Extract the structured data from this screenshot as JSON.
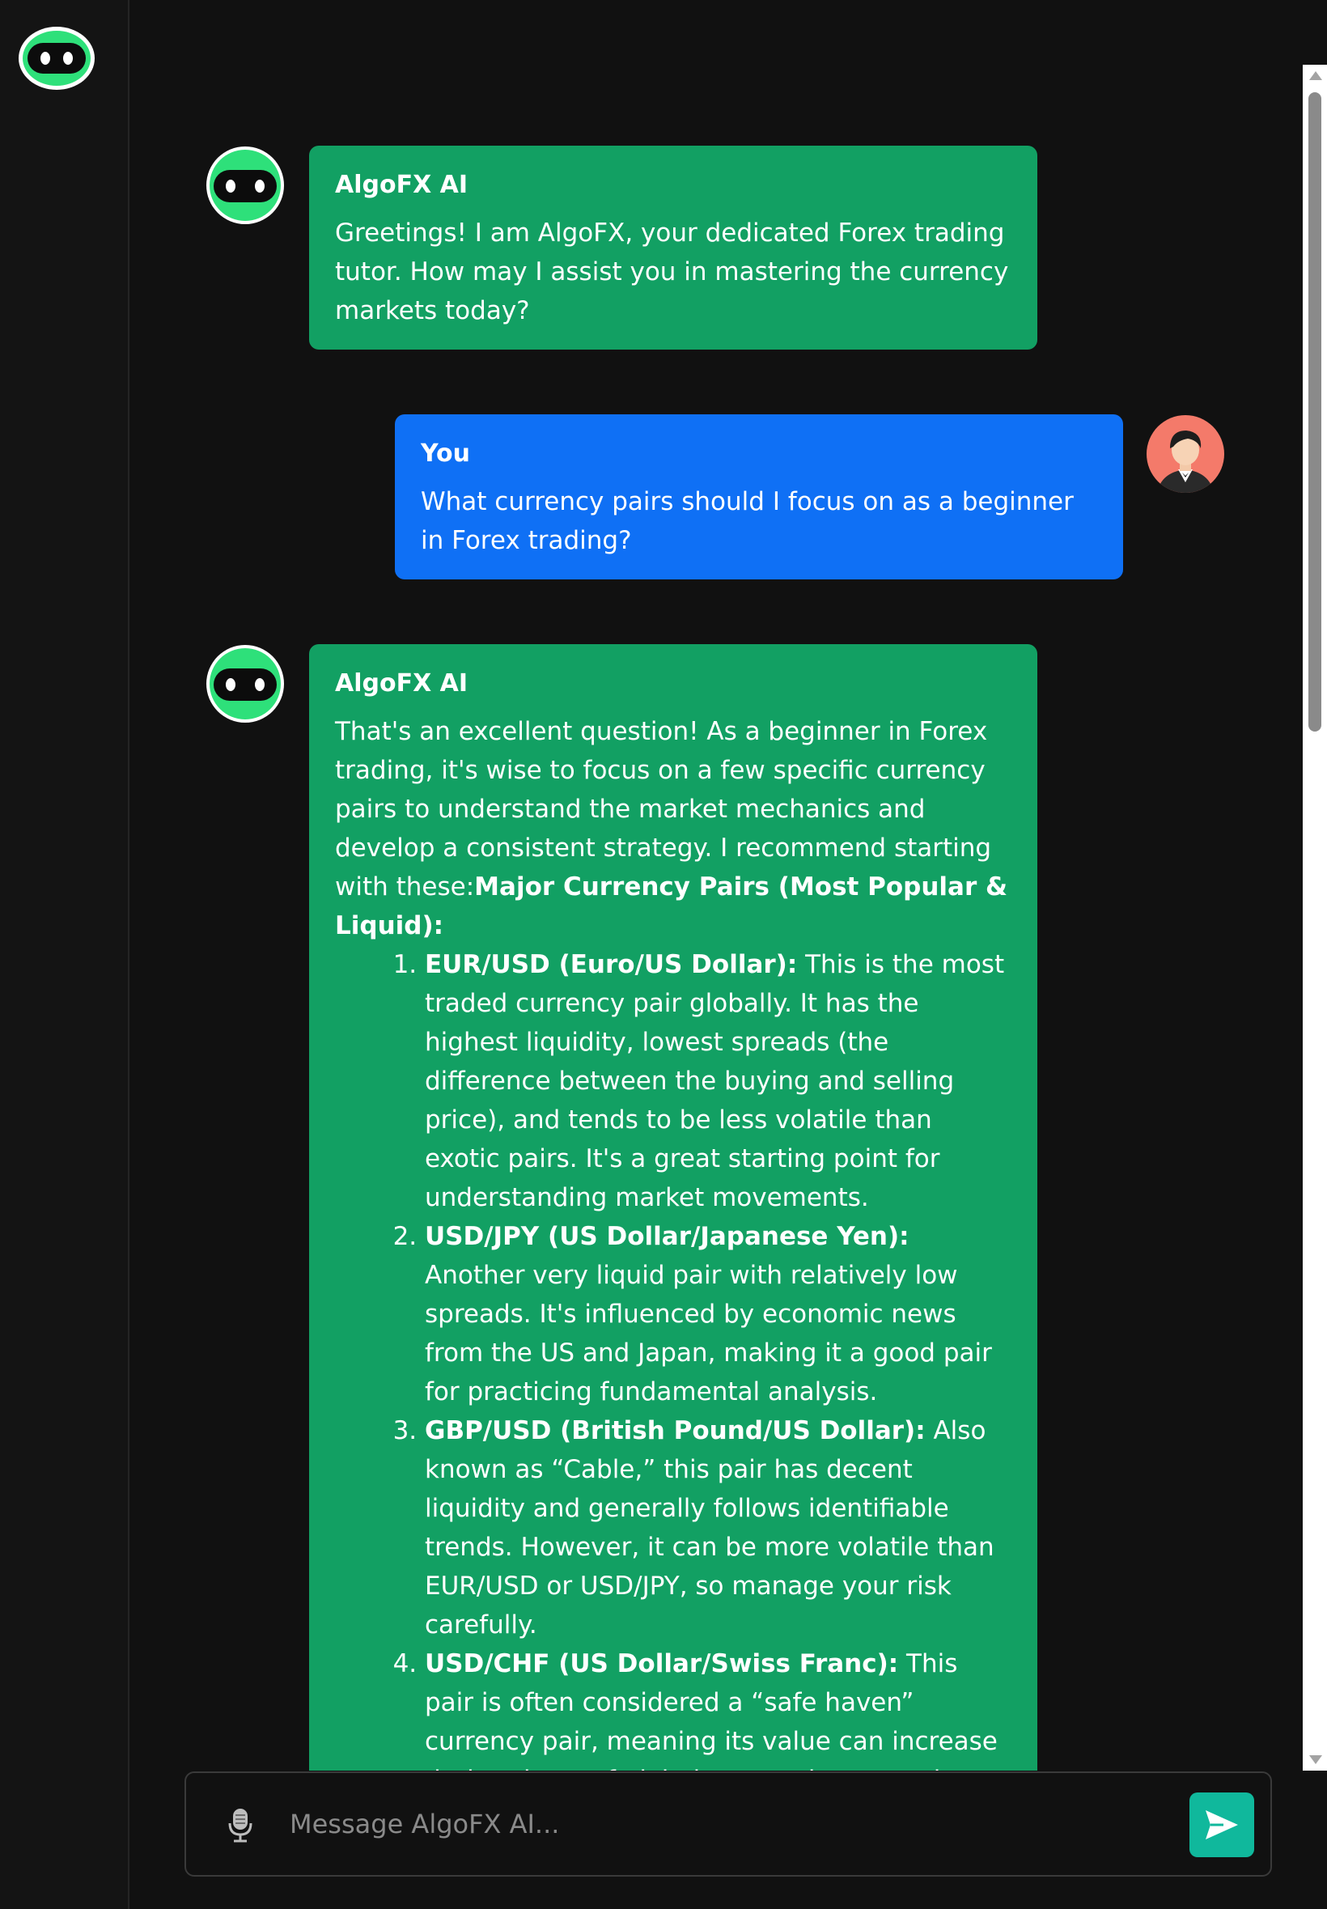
{
  "composer": {
    "placeholder": "Message AlgoFX AI...",
    "mic_icon": "microphone-icon",
    "send_icon": "send-arrow-icon"
  },
  "colors": {
    "background": "#111111",
    "sidebar": "#141414",
    "bot_bubble": "#12a063",
    "user_bubble": "#0f70f5",
    "send_button": "#10b89c",
    "bot_avatar_green": "#2ee07a"
  },
  "messages": [
    {
      "sender": "AlgoFX AI",
      "role": "bot",
      "text": "Greetings! I am AlgoFX, your dedicated Forex trading tutor. How may I assist you in mastering the currency markets today?"
    },
    {
      "sender": "You",
      "role": "user",
      "text": "What currency pairs should I focus on as a beginner in Forex trading?"
    },
    {
      "sender": "AlgoFX AI",
      "role": "bot",
      "intro": "That's an excellent question! As a beginner in Forex trading, it's wise to focus on a few specific currency pairs to understand the market mechanics and develop a consistent strategy. I recommend starting with these:",
      "section_heading": "Major Currency Pairs (Most Popular & Liquid):",
      "items": [
        {
          "title": "EUR/USD (Euro/US Dollar):",
          "text": " This is the most traded currency pair globally. It has the highest liquidity, lowest spreads (the difference between the buying and selling price), and tends to be less volatile than exotic pairs. It's a great starting point for understanding market movements."
        },
        {
          "title": "USD/JPY (US Dollar/Japanese Yen):",
          "text": " Another very liquid pair with relatively low spreads. It's influenced by economic news from the US and Japan, making it a good pair for practicing fundamental analysis."
        },
        {
          "title": "GBP/USD (British Pound/US Dollar):",
          "text": " Also known as “Cable,” this pair has decent liquidity and generally follows identifiable trends. However, it can be more volatile than EUR/USD or USD/JPY, so manage your risk carefully."
        },
        {
          "title": "USD/CHF (US Dollar/Swiss Franc):",
          "text": " This pair is often considered a “safe haven” currency pair, meaning its value can increase during times of global economic uncertainty. It's a good option for diversifying your portfolio and"
        }
      ]
    }
  ]
}
